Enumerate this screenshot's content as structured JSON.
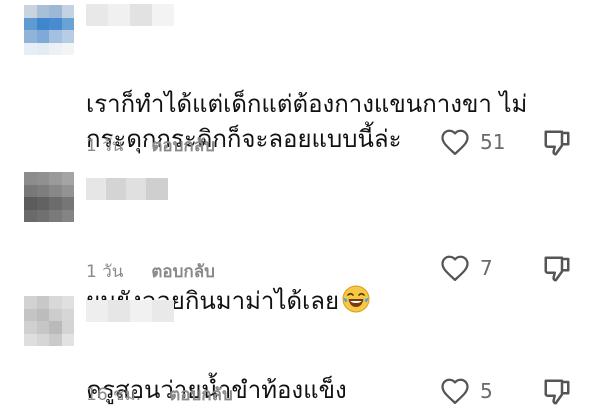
{
  "comments": [
    {
      "text": "เราก็ทำได้แต่เด็กแต่ต้องกางแขนกางขา ไม่\nกระดุกกระดิกก็จะลอยแบบนี้ล่ะ",
      "emoji": "",
      "time": "1 วัน",
      "reply_label": "ตอบกลับ",
      "likes": "51",
      "icons": {
        "like": "heart-icon",
        "dislike": "thumbs-down-icon"
      }
    },
    {
      "text": "ผมยังลอยกินมาม่าได้เลย",
      "emoji": "😂",
      "time": "1 วัน",
      "reply_label": "ตอบกลับ",
      "likes": "7",
      "icons": {
        "like": "heart-icon",
        "dislike": "thumbs-down-icon"
      }
    },
    {
      "text": "ครูสอนว่ายน้ำขำท้องแข็ง",
      "emoji": "",
      "time": "16 ชม.",
      "reply_label": "ตอบกลับ",
      "likes": "5",
      "icons": {
        "like": "heart-icon",
        "dislike": "thumbs-down-icon"
      }
    }
  ],
  "colors": {
    "text": "#111111",
    "meta": "#8a8a8a",
    "icon": "#555555",
    "background": "#ffffff"
  }
}
